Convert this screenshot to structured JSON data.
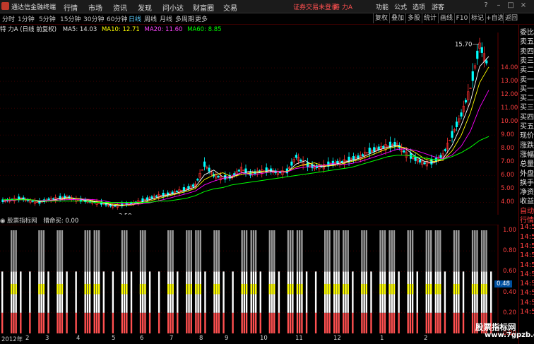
{
  "menu": {
    "app_title": "通达信金融终端",
    "items": [
      "行情",
      "市场",
      "资讯",
      "发现",
      "问小达",
      "财富圈",
      "交易"
    ],
    "status": "证券交易未登录",
    "stock_name": "特 力A",
    "right_items": [
      "功能",
      "公式",
      "选项",
      "游客"
    ]
  },
  "period_tabs": [
    "分时",
    "1分钟",
    "5分钟",
    "15分钟",
    "30分钟",
    "60分钟",
    "日线",
    "周线",
    "月线",
    "多周期",
    "更多"
  ],
  "active_period": "日线",
  "toolbar": [
    "复权",
    "叠加",
    "多股",
    "统计",
    "画线",
    "F10",
    "标记",
    "+自选",
    "返回"
  ],
  "info": {
    "title": "特 力A (日线 前复权)",
    "ma5": "MA5: 14.03",
    "ma10": "MA10: 12.71",
    "ma20": "MA20: 11.60",
    "ma60": "MA60: 8.85"
  },
  "colors": {
    "ma5": "#ffffff",
    "ma10": "#ffff00",
    "ma20": "#ff00ff",
    "ma60": "#00ff00",
    "up": "#ff3030",
    "down": "#00ffff",
    "grid": "#600000"
  },
  "indicator": {
    "title": "股票指标网",
    "label": "猎命买: 0.00"
  },
  "price_axis": [
    "14.00",
    "13.00",
    "12.00",
    "11.00",
    "10.00",
    "9.00",
    "8.00",
    "7.00",
    "6.00",
    "5.00",
    "4.00"
  ],
  "price_high_label": "15.70",
  "price_low_label": "3.59",
  "ind_axis": [
    "1.00",
    "0.80",
    "0.60",
    "0.48",
    "0.40",
    "0.20",
    "0.00"
  ],
  "ind_current": "0.48",
  "x_dates": [
    "2012年",
    "2",
    "3",
    "4",
    "5",
    "6",
    "7",
    "8",
    "9",
    "10",
    "11",
    "12",
    "1",
    "2"
  ],
  "right_panel": [
    "委比",
    "卖五",
    "卖四",
    "卖三",
    "卖二",
    "卖一",
    "买一",
    "买二",
    "买三",
    "买四",
    "买五",
    "现价",
    "涨跌",
    "涨幅",
    "总量",
    "外盘",
    "换手",
    "净资",
    "收益",
    "自动",
    "行情",
    "14:5",
    "14:5",
    "14:5",
    "14:5",
    "14:5",
    "14:5",
    "14:5",
    "14:5",
    "14:5",
    "14:5"
  ],
  "watermark": "股票指标网",
  "watermark_url": "www.7gpzb.com",
  "chart_data": {
    "type": "line",
    "title": "特 力A (日线 前复权)",
    "ylim": [
      3.5,
      16
    ],
    "close_series_approx": [
      4.1,
      4.2,
      4.3,
      4.1,
      4.0,
      4.2,
      4.3,
      4.4,
      4.2,
      4.1,
      4.0,
      3.9,
      3.7,
      3.8,
      3.9,
      4.1,
      4.3,
      4.5,
      4.6,
      4.8,
      5.0,
      5.3,
      6.8,
      6.0,
      5.8,
      5.9,
      6.5,
      6.1,
      6.3,
      6.4,
      6.2,
      6.3,
      7.4,
      6.8,
      6.6,
      6.7,
      6.9,
      7.0,
      7.2,
      7.4,
      7.8,
      8.0,
      8.2,
      8.3,
      7.6,
      7.2,
      6.9,
      7.0,
      7.5,
      9.0,
      10.5,
      12.5,
      15.7,
      14.0
    ],
    "ma60_approx": [
      4.2,
      4.2,
      4.2,
      4.2,
      4.1,
      4.1,
      4.1,
      4.1,
      4.1,
      4.1,
      4.0,
      4.0,
      4.0,
      4.0,
      4.0,
      4.0,
      4.0,
      4.1,
      4.1,
      4.2,
      4.3,
      4.5,
      4.8,
      5.0,
      5.1,
      5.3,
      5.4,
      5.5,
      5.6,
      5.7,
      5.8,
      5.9,
      6.0,
      6.1,
      6.2,
      6.3,
      6.4,
      6.5,
      6.6,
      6.8,
      7.0,
      7.2,
      7.4,
      7.5,
      7.5,
      7.4,
      7.3,
      7.2,
      7.2,
      7.4,
      7.7,
      8.1,
      8.6,
      8.9
    ],
    "indicator_signals_approx": [
      0,
      1,
      0,
      0,
      1,
      0,
      1,
      0,
      0,
      1,
      1,
      0,
      0,
      1,
      0,
      1,
      0,
      0,
      1,
      0,
      1,
      1,
      0,
      1,
      0,
      0,
      1,
      1,
      0,
      1,
      0,
      1,
      1,
      0,
      0,
      1,
      1,
      1,
      0,
      1,
      0,
      1,
      1,
      0,
      1,
      0,
      1,
      1,
      0,
      1,
      0,
      1,
      1,
      0
    ]
  }
}
